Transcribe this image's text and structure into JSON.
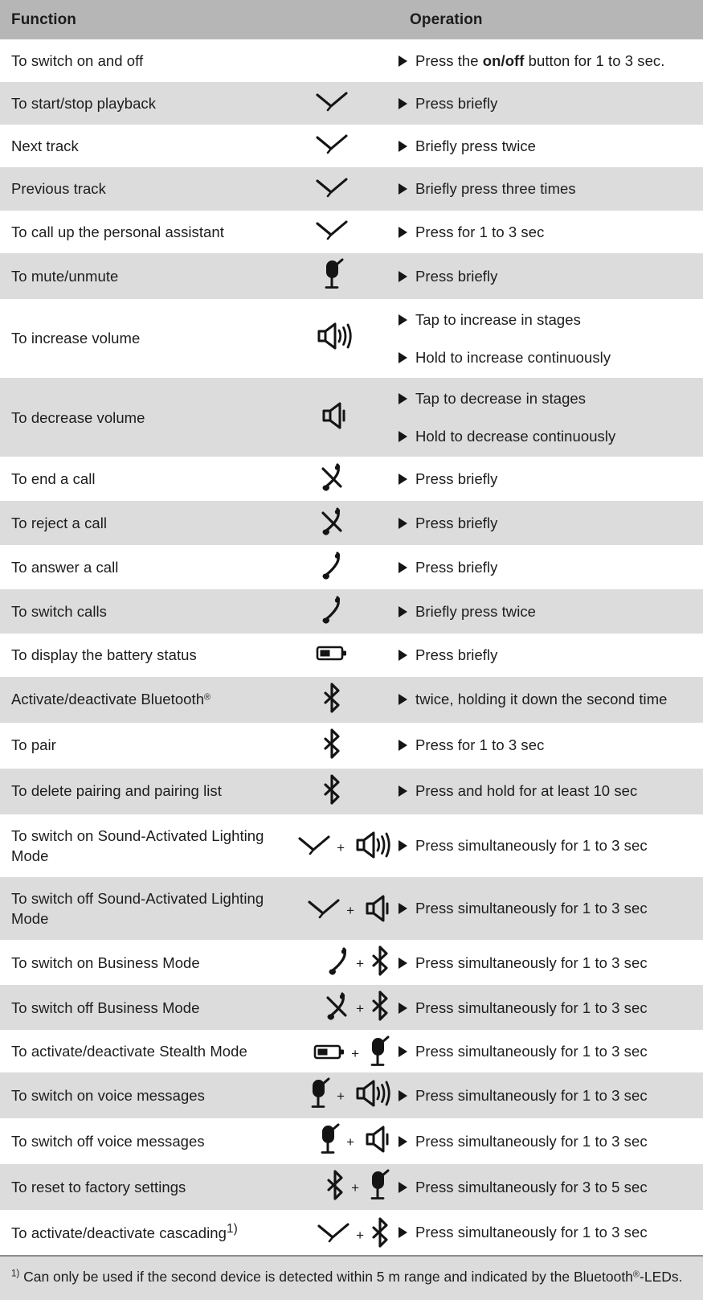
{
  "table": {
    "headers": {
      "function": "Function",
      "icon": "",
      "operation": "Operation"
    },
    "plus_symbol": "+",
    "rows": [
      {
        "function": "To switch on and off",
        "icons": [],
        "operations": [
          "Press the <b>on/off</b> button for 1 to 3 sec."
        ],
        "shaded": false
      },
      {
        "function": "To start/stop playback",
        "icons": [
          "multifunction-button-icon"
        ],
        "operations": [
          "Press briefly"
        ],
        "shaded": true
      },
      {
        "function": "Next track",
        "icons": [
          "multifunction-button-icon"
        ],
        "operations": [
          "Briefly press twice"
        ],
        "shaded": false
      },
      {
        "function": "Previous track",
        "icons": [
          "multifunction-button-icon"
        ],
        "operations": [
          "Briefly press three times"
        ],
        "shaded": true
      },
      {
        "function": "To call up the personal assistant",
        "icons": [
          "multifunction-button-icon"
        ],
        "operations": [
          "Press for 1 to 3 sec"
        ],
        "shaded": false
      },
      {
        "function": "To mute/unmute",
        "icons": [
          "microphone-icon"
        ],
        "operations": [
          "Press briefly"
        ],
        "shaded": true
      },
      {
        "function": "To increase volume",
        "icons": [
          "volume-up-icon"
        ],
        "operations": [
          "Tap to increase in stages",
          "Hold to increase continuously"
        ],
        "shaded": false
      },
      {
        "function": "To decrease volume",
        "icons": [
          "volume-down-icon"
        ],
        "operations": [
          "Tap to decrease in stages",
          "Hold to decrease continuously"
        ],
        "shaded": true
      },
      {
        "function": "To end a call",
        "icons": [
          "end-call-icon"
        ],
        "operations": [
          "Press briefly"
        ],
        "shaded": false
      },
      {
        "function": "To reject a call",
        "icons": [
          "end-call-icon"
        ],
        "operations": [
          "Press briefly"
        ],
        "shaded": true
      },
      {
        "function": "To answer a call",
        "icons": [
          "answer-call-icon"
        ],
        "operations": [
          "Press briefly"
        ],
        "shaded": false
      },
      {
        "function": "To switch calls",
        "icons": [
          "answer-call-icon"
        ],
        "operations": [
          "Briefly press twice"
        ],
        "shaded": true
      },
      {
        "function": "To display the battery status",
        "icons": [
          "battery-icon"
        ],
        "operations": [
          "Press briefly"
        ],
        "shaded": false
      },
      {
        "function": "Activate/deactivate Bluetooth<span class=\"reg\">®</span>",
        "icons": [
          "bluetooth-icon"
        ],
        "operations": [
          "twice, holding it down the second time"
        ],
        "shaded": true
      },
      {
        "function": "To pair",
        "icons": [
          "bluetooth-icon"
        ],
        "operations": [
          "Press for 1 to 3 sec"
        ],
        "shaded": false
      },
      {
        "function": "To delete pairing and pairing list",
        "icons": [
          "bluetooth-icon"
        ],
        "operations": [
          "Press and hold for at least 10 sec"
        ],
        "shaded": true
      },
      {
        "function": "To switch on Sound-Activated Lighting Mode",
        "icons": [
          "multifunction-button-icon",
          "volume-up-icon"
        ],
        "operations": [
          "Press simultaneously for 1 to 3 sec"
        ],
        "shaded": false
      },
      {
        "function": "To switch off Sound-Activated Lighting Mode",
        "icons": [
          "multifunction-button-icon",
          "volume-down-icon"
        ],
        "operations": [
          "Press simultaneously for 1 to 3 sec"
        ],
        "shaded": true
      },
      {
        "function": "To switch on Business Mode",
        "icons": [
          "answer-call-icon",
          "bluetooth-icon"
        ],
        "operations": [
          "Press simultaneously for 1 to 3 sec"
        ],
        "shaded": false
      },
      {
        "function": "To switch off Business Mode",
        "icons": [
          "end-call-icon",
          "bluetooth-icon"
        ],
        "operations": [
          "Press simultaneously for 1 to 3 sec"
        ],
        "shaded": true
      },
      {
        "function": "To activate/deactivate Stealth Mode",
        "icons": [
          "battery-icon",
          "microphone-icon"
        ],
        "operations": [
          "Press simultaneously for 1 to 3 sec"
        ],
        "shaded": false
      },
      {
        "function": "To switch on voice messages",
        "icons": [
          "microphone-icon",
          "volume-up-icon"
        ],
        "operations": [
          "Press simultaneously for 1 to 3 sec"
        ],
        "shaded": true
      },
      {
        "function": "To switch off voice messages",
        "icons": [
          "microphone-icon",
          "volume-down-icon"
        ],
        "operations": [
          "Press simultaneously for 1 to 3 sec"
        ],
        "shaded": false
      },
      {
        "function": "To reset to factory settings",
        "icons": [
          "bluetooth-icon",
          "microphone-icon"
        ],
        "operations": [
          "Press simultaneously for 3 to 5 sec"
        ],
        "shaded": true
      },
      {
        "function": "To activate/deactivate cascading<sup>1)</sup>",
        "icons": [
          "multifunction-button-icon",
          "bluetooth-icon"
        ],
        "operations": [
          "Press simultaneously for 1 to 3 sec"
        ],
        "shaded": false
      }
    ]
  },
  "footnote": {
    "marker": "1)",
    "text": "Can only be used if the second device is detected within 5 m range and indicated by the Bluetooth<span class=\"reg\">®</span>-LEDs."
  }
}
